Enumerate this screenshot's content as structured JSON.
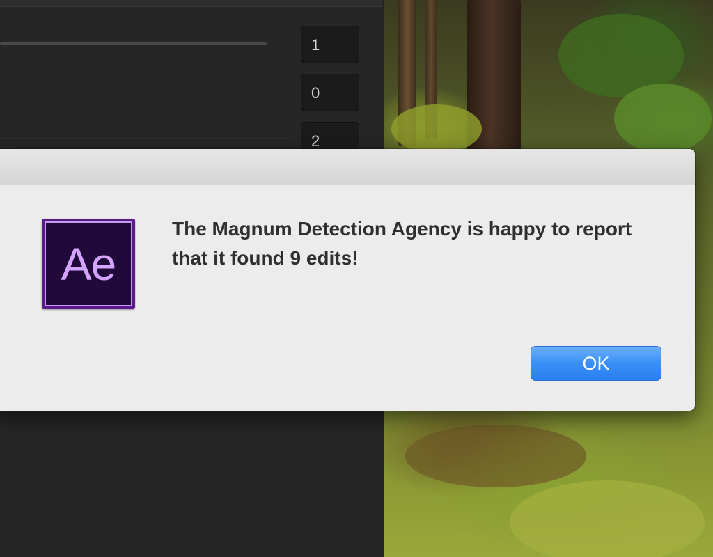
{
  "background_panel": {
    "values": [
      "1",
      "0",
      "2"
    ]
  },
  "dialog": {
    "message": "The Magnum Detection Agency is happy to report that it found 9 edits!",
    "app_icon_text": "Ae",
    "ok_label": "OK"
  },
  "colors": {
    "button_accent": "#3a8ff5",
    "app_icon_bg": "#1f0a3a",
    "app_icon_text": "#d3a3ff"
  }
}
